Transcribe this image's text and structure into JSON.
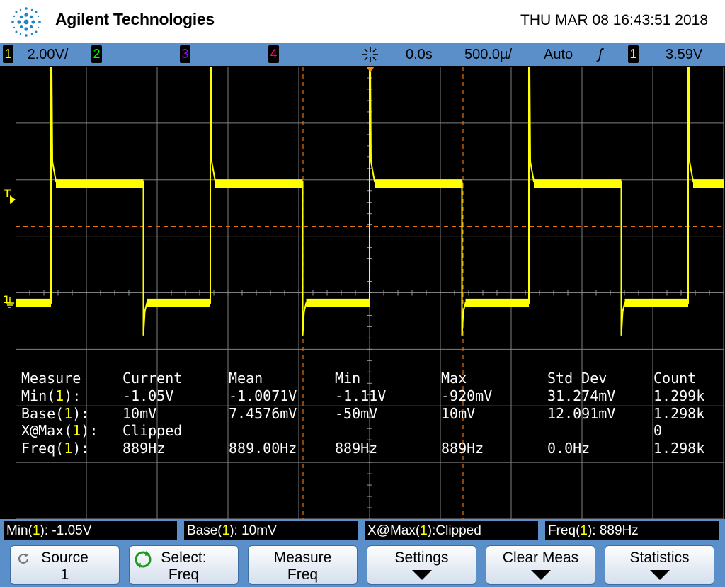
{
  "header": {
    "brand": "Agilent Technologies",
    "datetime": "THU MAR 08 16:43:51 2018"
  },
  "status": {
    "ch1_num": "1",
    "ch1_scale": "2.00V/",
    "ch2_num": "2",
    "ch3_num": "3",
    "ch4_num": "4",
    "time_offset": "0.0s",
    "timebase": "500.0µ/",
    "trigger_mode": "Auto",
    "trigger_slope": "ʃ",
    "trigger_source": "1",
    "trigger_level": "3.59V"
  },
  "markers": {
    "trigger_level": "T",
    "ch1_ground": "1"
  },
  "waveform": {
    "channel": "1",
    "high_level_div": 1.97,
    "low_level_div": -0.18,
    "period_div": 2.25,
    "duty": 0.58
  },
  "measurements": {
    "headers": [
      "Measure",
      "Current",
      "Mean",
      "Min",
      "Max",
      "Std Dev",
      "Count"
    ],
    "rows": [
      {
        "name_pre": "Min(",
        "ch": "1",
        "name_post": "):",
        "values": [
          "-1.05V",
          "-1.0071V",
          "-1.11V",
          "-920mV",
          "31.274mV",
          "1.299k"
        ]
      },
      {
        "name_pre": "Base(",
        "ch": "1",
        "name_post": "):",
        "values": [
          "10mV",
          "7.4576mV",
          "-50mV",
          "10mV",
          "12.091mV",
          "1.298k"
        ]
      },
      {
        "name_pre": "X@Max(",
        "ch": "1",
        "name_post": "):",
        "values": [
          "Clipped",
          "",
          "",
          "",
          "",
          "0"
        ]
      },
      {
        "name_pre": "Freq(",
        "ch": "1",
        "name_post": "):",
        "values": [
          "889Hz",
          "889.00Hz",
          "889Hz",
          "889Hz",
          "0.0Hz",
          "1.298k"
        ]
      }
    ]
  },
  "readouts": [
    {
      "pre": "Min(",
      "ch": "1",
      "post": "): -1.05V"
    },
    {
      "pre": "Base(",
      "ch": "1",
      "post": "): 10mV"
    },
    {
      "pre": "X@Max(",
      "ch": "1",
      "post": "):Clipped"
    },
    {
      "pre": "Freq(",
      "ch": "1",
      "post": "): 889Hz"
    }
  ],
  "softkeys": [
    {
      "line1": "Source",
      "line2": "1",
      "icon": "rotate-knob-icon"
    },
    {
      "line1": "Select:",
      "line2": "Freq",
      "icon": "green-rotate-knob-icon"
    },
    {
      "line1": "Measure",
      "line2": "Freq"
    },
    {
      "line1": "Settings",
      "arrow": true
    },
    {
      "line1": "Clear Meas",
      "arrow": true
    },
    {
      "line1": "Statistics",
      "arrow": true
    }
  ],
  "colors": {
    "ch1": "#ffff00",
    "ch2": "#00ff00",
    "ch3": "#9900ff",
    "ch4": "#ff0066",
    "frame_blue": "#5a8fc9",
    "trigger": "#ff8c00"
  }
}
